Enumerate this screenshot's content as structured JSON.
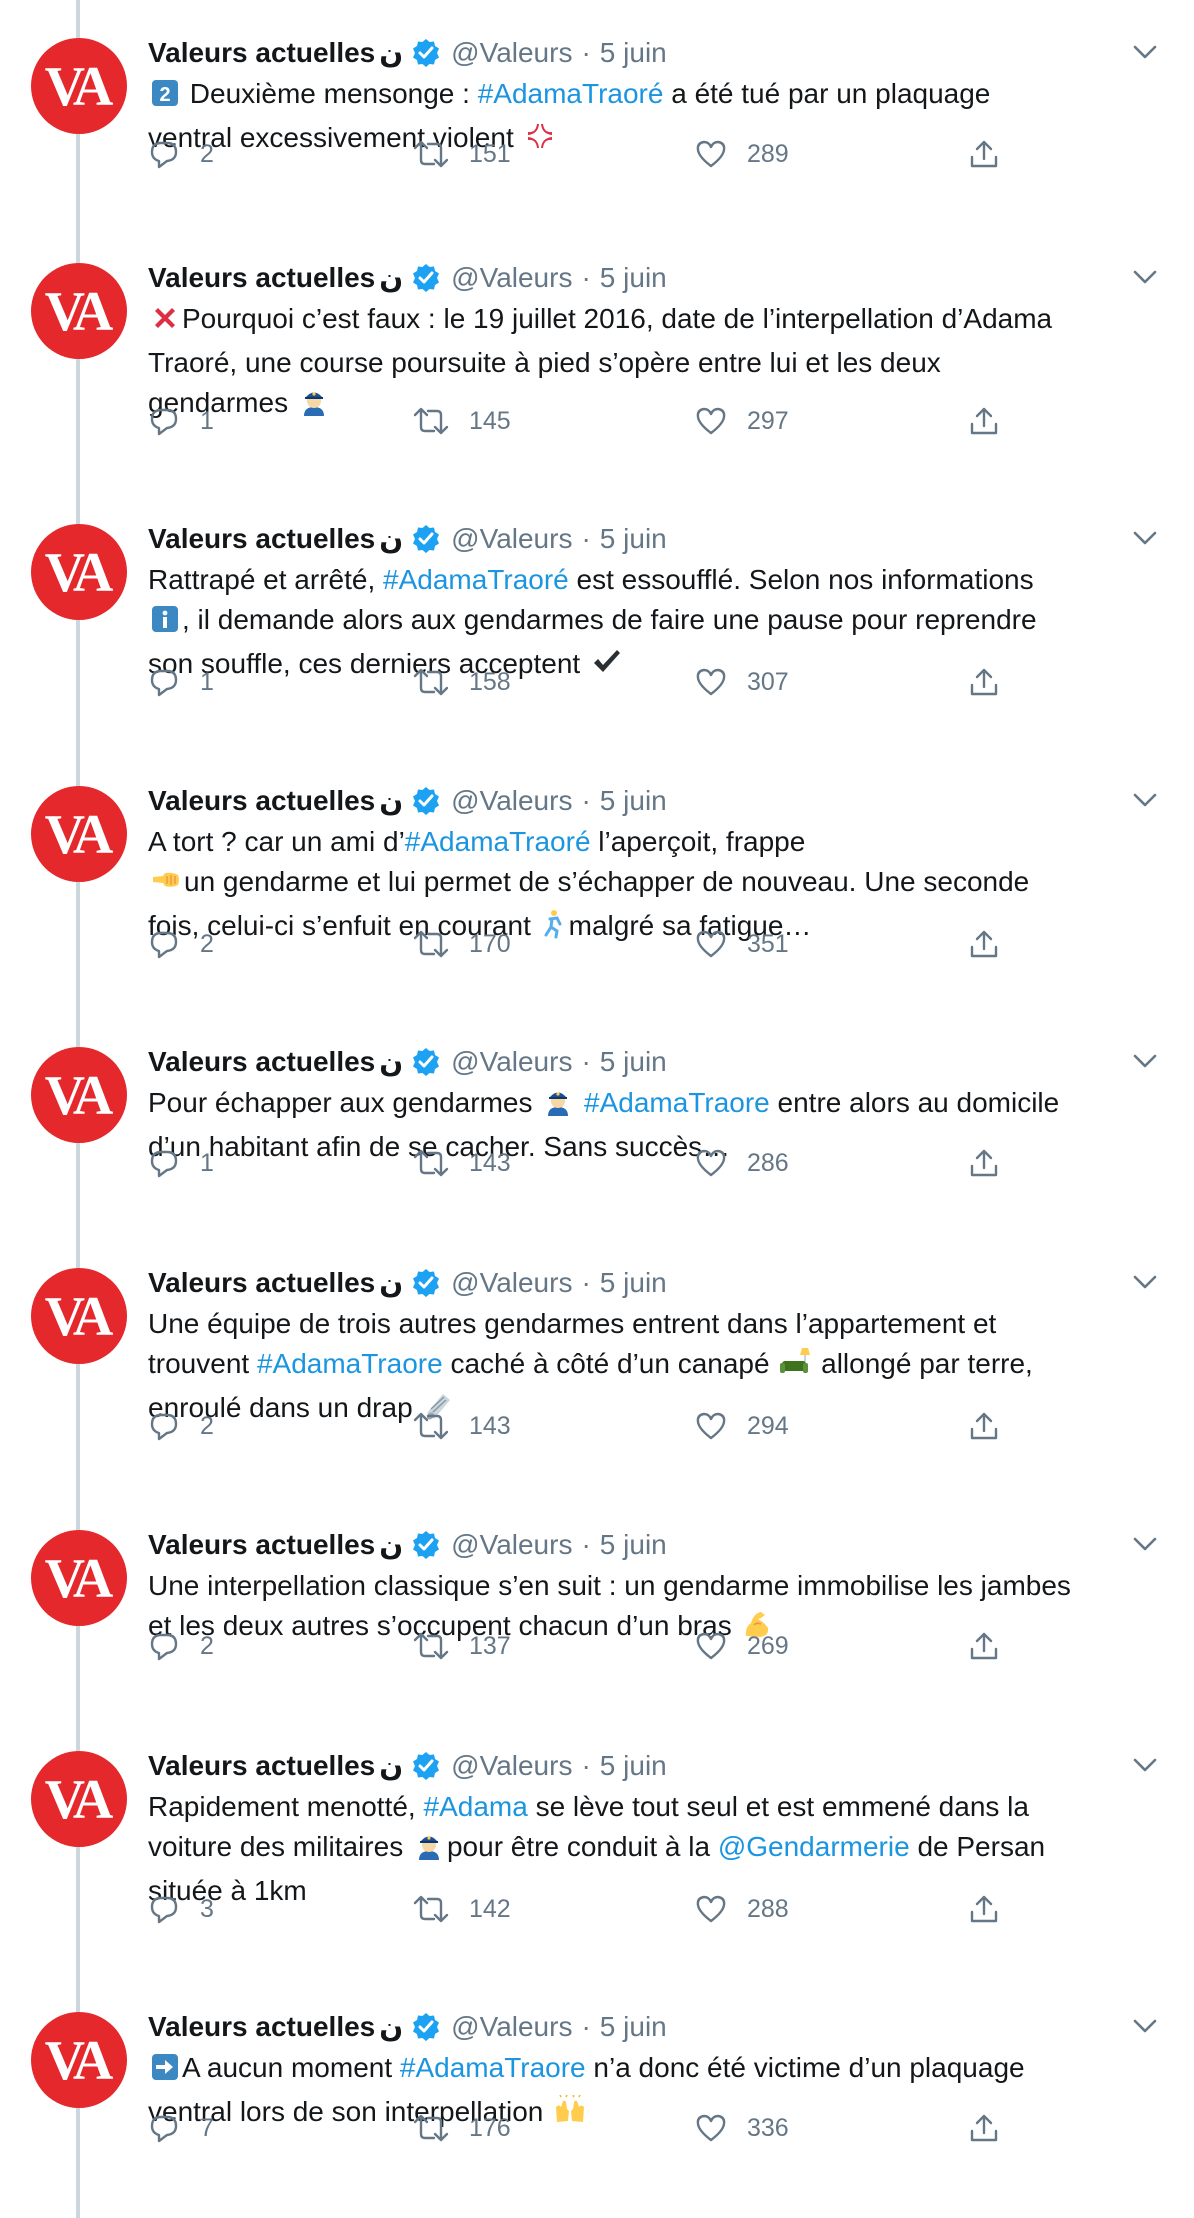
{
  "account": {
    "name": "Valeurs actuelles",
    "name_glyph": "ن",
    "handle": "@Valeurs",
    "date": "5 juin",
    "separator": "·",
    "avatar_text": "VA",
    "avatar_color": "#e4282c",
    "verified_color": "#1da1f2"
  },
  "colors": {
    "link": "#1b95e0",
    "muted": "#657786",
    "text": "#14171a",
    "thread_line": "#ccd6dd"
  },
  "tweets": [
    {
      "lines": [
        [
          "[2]",
          " Deuxième mensonge : ",
          "#AdamaTraoré",
          " a été tué par un plaquage"
        ],
        [
          "ventral excessivement violent ",
          "[anger]"
        ]
      ],
      "replies": "2",
      "retweets": "151",
      "likes": "289"
    },
    {
      "lines": [
        [
          "[x]",
          "Pourquoi c’est faux : le 19 juillet 2016, date de l’interpellation d’Adama"
        ],
        [
          "Traoré, une course poursuite à pied s’opère entre lui et les deux"
        ],
        [
          "gendarmes ",
          "[police]"
        ]
      ],
      "replies": "1",
      "retweets": "145",
      "likes": "297"
    },
    {
      "lines": [
        [
          "Rattrapé et arrêté, ",
          "#AdamaTraoré",
          " est essoufflé. Selon nos informations"
        ],
        [
          "[i]",
          ", il demande alors aux gendarmes de faire une pause pour reprendre"
        ],
        [
          "son souffle, ces derniers acceptent ",
          "[check]"
        ]
      ],
      "replies": "1",
      "retweets": "158",
      "likes": "307"
    },
    {
      "lines": [
        [
          "A tort ? car un ami d’",
          "#AdamaTraoré",
          " l’aperçoit, frappe"
        ],
        [
          "[fist]",
          "un gendarme et lui permet de s’échapper de nouveau. Une seconde"
        ],
        [
          "fois, celui-ci s’enfuit en courant ",
          "[run]",
          "malgré sa fatigue…"
        ]
      ],
      "replies": "2",
      "retweets": "170",
      "likes": "351"
    },
    {
      "lines": [
        [
          "Pour échapper aux gendarmes ",
          "[police]",
          " ",
          "#AdamaTraore",
          " entre alors au domicile"
        ],
        [
          "d’un habitant afin de se cacher. Sans succès…"
        ]
      ],
      "replies": "1",
      "retweets": "143",
      "likes": "286"
    },
    {
      "lines": [
        [
          "Une équipe de trois autres gendarmes entrent dans l’appartement et"
        ],
        [
          "trouvent ",
          "#AdamaTraore",
          " caché à côté d’un canapé ",
          "[couch]",
          " allongé par terre,"
        ],
        [
          "enroulé dans un drap ",
          "[roll]"
        ]
      ],
      "replies": "2",
      "retweets": "143",
      "likes": "294"
    },
    {
      "lines": [
        [
          "Une interpellation classique s’en suit : un gendarme immobilise les jambes"
        ],
        [
          "et les deux autres s’occupent chacun d’un bras ",
          "[muscle]"
        ]
      ],
      "replies": "2",
      "retweets": "137",
      "likes": "269"
    },
    {
      "lines": [
        [
          "Rapidement menotté, ",
          "#Adama",
          " se lève tout seul et est emmené dans la"
        ],
        [
          "voiture des militaires ",
          "[police]",
          "pour être conduit à la ",
          "@Gendarmerie",
          " de Persan"
        ],
        [
          "située à 1km"
        ]
      ],
      "replies": "3",
      "retweets": "142",
      "likes": "288"
    },
    {
      "lines": [
        [
          "[arrow]",
          "A aucun moment ",
          "#AdamaTraore",
          " n’a donc été victime d’un plaquage"
        ],
        [
          "ventral lors de son interpellation ",
          "[hands]"
        ]
      ],
      "replies": "7",
      "retweets": "176",
      "likes": "336"
    }
  ]
}
